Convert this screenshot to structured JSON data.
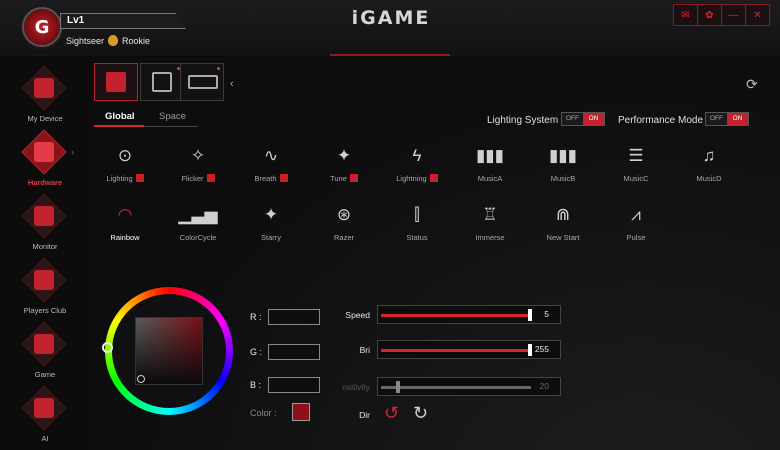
{
  "window": {
    "brand": "iGAME",
    "user": {
      "level": "Lv1",
      "title": "Sightseer",
      "rank": "Rookie",
      "logo_letter": "G"
    },
    "controls": [
      "notice",
      "feedback",
      "minimize",
      "close"
    ]
  },
  "sidebar": {
    "items": [
      {
        "label": "My Device",
        "icon": "monitor-icon",
        "active": false
      },
      {
        "label": "Hardware",
        "icon": "hardware-icon",
        "active": true
      },
      {
        "label": "Monitor",
        "icon": "gauge-icon",
        "active": false
      },
      {
        "label": "Players Club",
        "icon": "club-icon",
        "active": false
      },
      {
        "label": "Game",
        "icon": "gamepad-icon",
        "active": false
      },
      {
        "label": "AI",
        "icon": "ai-icon",
        "active": false
      }
    ]
  },
  "devices": [
    "cooler",
    "motherboard",
    "memory"
  ],
  "tabs": {
    "global": "Global",
    "space": "Space"
  },
  "modes": {
    "lighting_system": {
      "label": "Lighting System",
      "off": "OFF",
      "on": "ON",
      "value": "ON"
    },
    "performance_mode": {
      "label": "Performance Mode",
      "off": "OFF",
      "on": "ON",
      "value": "ON"
    }
  },
  "effects": [
    {
      "label": "Lighting",
      "glyph": "⊙",
      "marked": true
    },
    {
      "label": "Flicker",
      "glyph": "✧",
      "marked": true
    },
    {
      "label": "Breath",
      "glyph": "∿",
      "marked": true
    },
    {
      "label": "Tune",
      "glyph": "✦",
      "marked": true
    },
    {
      "label": "Lightning",
      "glyph": "ϟ",
      "marked": true
    },
    {
      "label": "MusicA",
      "glyph": "▮▮▮",
      "marked": false
    },
    {
      "label": "MusicB",
      "glyph": "▮▮▮",
      "marked": false
    },
    {
      "label": "MusicC",
      "glyph": "☰",
      "marked": false
    },
    {
      "label": "MusicD",
      "glyph": "♫",
      "marked": false
    },
    {
      "label": "Rainbow",
      "glyph": "◠",
      "marked": false,
      "active": true
    },
    {
      "label": "ColorCycle",
      "glyph": "▁▃▅",
      "marked": false
    },
    {
      "label": "Starry",
      "glyph": "✦",
      "marked": false
    },
    {
      "label": "Razer",
      "glyph": "⊛",
      "marked": false
    },
    {
      "label": "Status",
      "glyph": "⫿",
      "marked": false
    },
    {
      "label": "Immerse",
      "glyph": "♖",
      "marked": false
    },
    {
      "label": "New Start",
      "glyph": "⋒",
      "marked": false
    },
    {
      "label": "Pulse",
      "glyph": "⩘",
      "marked": false
    }
  ],
  "color": {
    "r_label": "R :",
    "g_label": "G :",
    "b_label": "B :",
    "r": "",
    "g": "",
    "b": "",
    "color_label": "Color :",
    "swatch": "#8a1218"
  },
  "sliders": [
    {
      "label": "Speed",
      "value": "5",
      "fraction": 1.0,
      "enabled": true
    },
    {
      "label": "Bri",
      "value": "255",
      "fraction": 1.0,
      "enabled": true
    },
    {
      "label": "nsitivity",
      "value": "20",
      "fraction": 0.1,
      "enabled": false
    }
  ],
  "direction": {
    "label": "Dir",
    "ccw": "↺",
    "cw": "↻"
  }
}
